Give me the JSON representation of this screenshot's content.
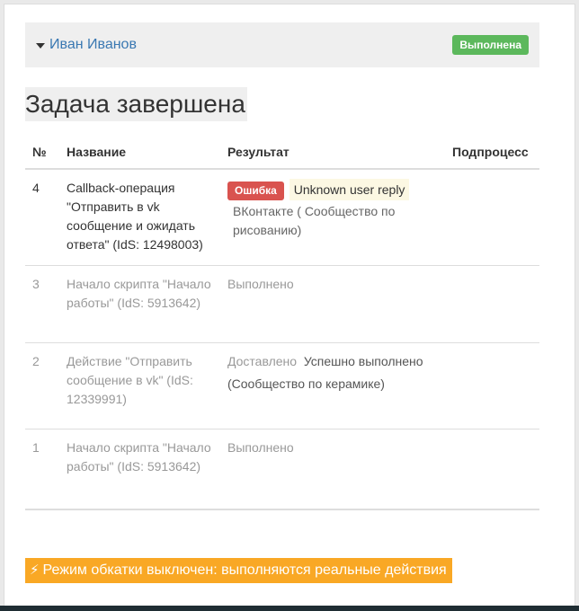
{
  "header": {
    "user_name": "Иван Иванов",
    "status_badge": "Выполнена",
    "colors": {
      "badge": "#5cb85c",
      "link": "#3a78b2"
    }
  },
  "page_title": "Задача завершена",
  "table": {
    "columns": [
      "№",
      "Название",
      "Результат",
      "Подпроцесс"
    ],
    "rows": [
      {
        "num": "4",
        "name": "Callback-операция \"Отправить в vk сообщение и ожидать ответа\" (IdS: 12498003)",
        "result_label": "Ошибка",
        "result_code": "Unknown user reply",
        "result_text": "ВКонтакте ( Сообщество по рисованию)",
        "subprocess": ""
      },
      {
        "num": "3",
        "name": "Начало скрипта \"Начало работы\" (IdS: 5913642)",
        "result_text": "Выполнено",
        "subprocess": ""
      },
      {
        "num": "2",
        "name": "Действие \"Отправить сообщение в vk\" (IdS: 12339991)",
        "result_prefix": "Доставлено",
        "result_text": "Успешно выполнено (Сообщество по керамике)",
        "subprocess": ""
      },
      {
        "num": "1",
        "name": "Начало скрипта \"Начало работы\" (IdS: 5913642)",
        "result_text": "Выполнено",
        "subprocess": ""
      }
    ]
  },
  "warning": {
    "icon": "lightning-icon",
    "text": "Режим обкатки выключен: выполняются реальные действия",
    "color": "#f9a825"
  }
}
